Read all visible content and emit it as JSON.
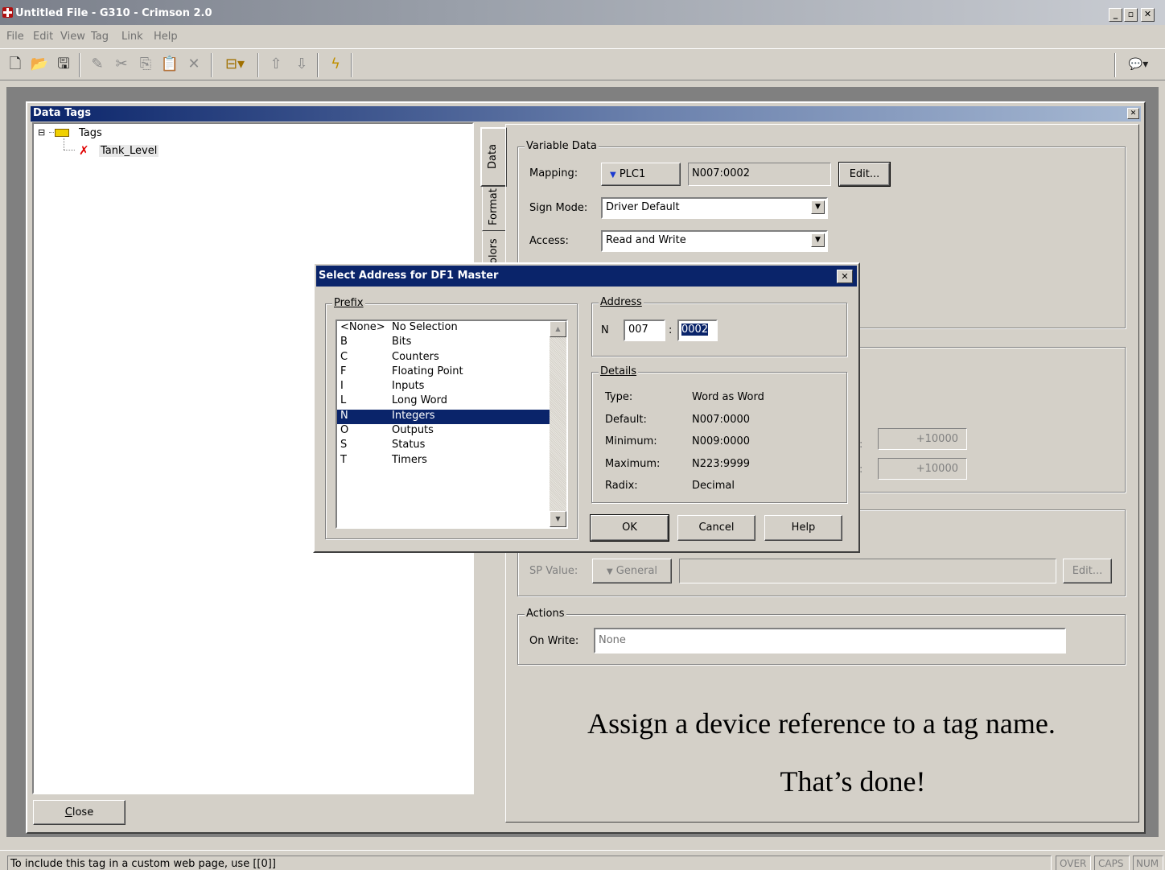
{
  "window": {
    "title": "Untitled File - G310 - Crimson 2.0",
    "min": "_",
    "max": "▫",
    "close": "✕"
  },
  "menu": [
    "File",
    "Edit",
    "View",
    "Tag",
    "Link",
    "Help"
  ],
  "toolbar": {
    "icons": [
      "new-file-icon",
      "open-folder-icon",
      "save-icon",
      "pencil-icon",
      "cut-icon",
      "copy-icon",
      "paste-icon",
      "delete-icon",
      "tag-icon",
      "up-arrow-icon",
      "down-arrow-icon",
      "lightning-icon",
      "comment-icon"
    ],
    "glyphs": {
      "new": "🗋",
      "open": "📂",
      "save": "🖫",
      "pencil": "✎",
      "cut": "✂",
      "copy": "⎘",
      "paste": "📋",
      "delete": "✕",
      "tag": "⊟▾",
      "up": "⇧",
      "down": "⇩",
      "bolt": "ϟ",
      "comment": "💬▾"
    }
  },
  "panel": {
    "title": "Data Tags",
    "close": "✕"
  },
  "tree": {
    "root": "Tags",
    "child": "Tank_Level",
    "expander": "⊟",
    "error_mark": "✗"
  },
  "close_button": {
    "prefix": "C",
    "rest": "lose"
  },
  "tabs": [
    "Data",
    "Format",
    "olors"
  ],
  "variable_data": {
    "legend": "Variable Data",
    "mapping_label": "Mapping:",
    "mapping_device": "PLC1",
    "mapping_address": "N007:0002",
    "edit_label": "Edit...",
    "sign_mode_label": "Sign Mode:",
    "sign_mode_value": "Driver Default",
    "access_label": "Access:",
    "access_value": "Read and Write"
  },
  "scaling": {
    "value1": "+10000",
    "value2": "+10000",
    "colon": ":"
  },
  "setpoint": {
    "label": "SP Value:",
    "source": "General",
    "edit_label": "Edit..."
  },
  "actions": {
    "legend": "Actions",
    "on_write_label": "On Write:",
    "on_write_value": "None"
  },
  "caption": {
    "line1": "Assign a device reference to a tag name.",
    "line2": "That’s done!"
  },
  "dialog": {
    "title": "Select Address for DF1 Master",
    "close": "✕",
    "prefix_legend": "Prefix",
    "prefix_items": [
      {
        "code": "<None>",
        "name": "No Selection"
      },
      {
        "code": "B",
        "name": "Bits"
      },
      {
        "code": "C",
        "name": "Counters"
      },
      {
        "code": "F",
        "name": "Floating Point"
      },
      {
        "code": "I",
        "name": "Inputs"
      },
      {
        "code": "L",
        "name": "Long Word"
      },
      {
        "code": "N",
        "name": "Integers"
      },
      {
        "code": "O",
        "name": "Outputs"
      },
      {
        "code": "S",
        "name": "Status"
      },
      {
        "code": "T",
        "name": "Timers"
      }
    ],
    "selected_prefix": "N",
    "address_legend": "Address",
    "address_prefix": "N",
    "address_file": "007",
    "address_sep": ":",
    "address_element": "0002",
    "details_legend": "Details",
    "details": [
      {
        "label": "Type:",
        "value": "Word as Word"
      },
      {
        "label": "Default:",
        "value": "N007:0000"
      },
      {
        "label": "Minimum:",
        "value": "N009:0000"
      },
      {
        "label": "Maximum:",
        "value": "N223:9999"
      },
      {
        "label": "Radix:",
        "value": "Decimal"
      }
    ],
    "ok": "OK",
    "cancel": "Cancel",
    "help": "Help"
  },
  "status": {
    "text": "To include this tag in a custom web page, use [[0]]",
    "over": "OVER",
    "caps": "CAPS",
    "num": "NUM"
  }
}
